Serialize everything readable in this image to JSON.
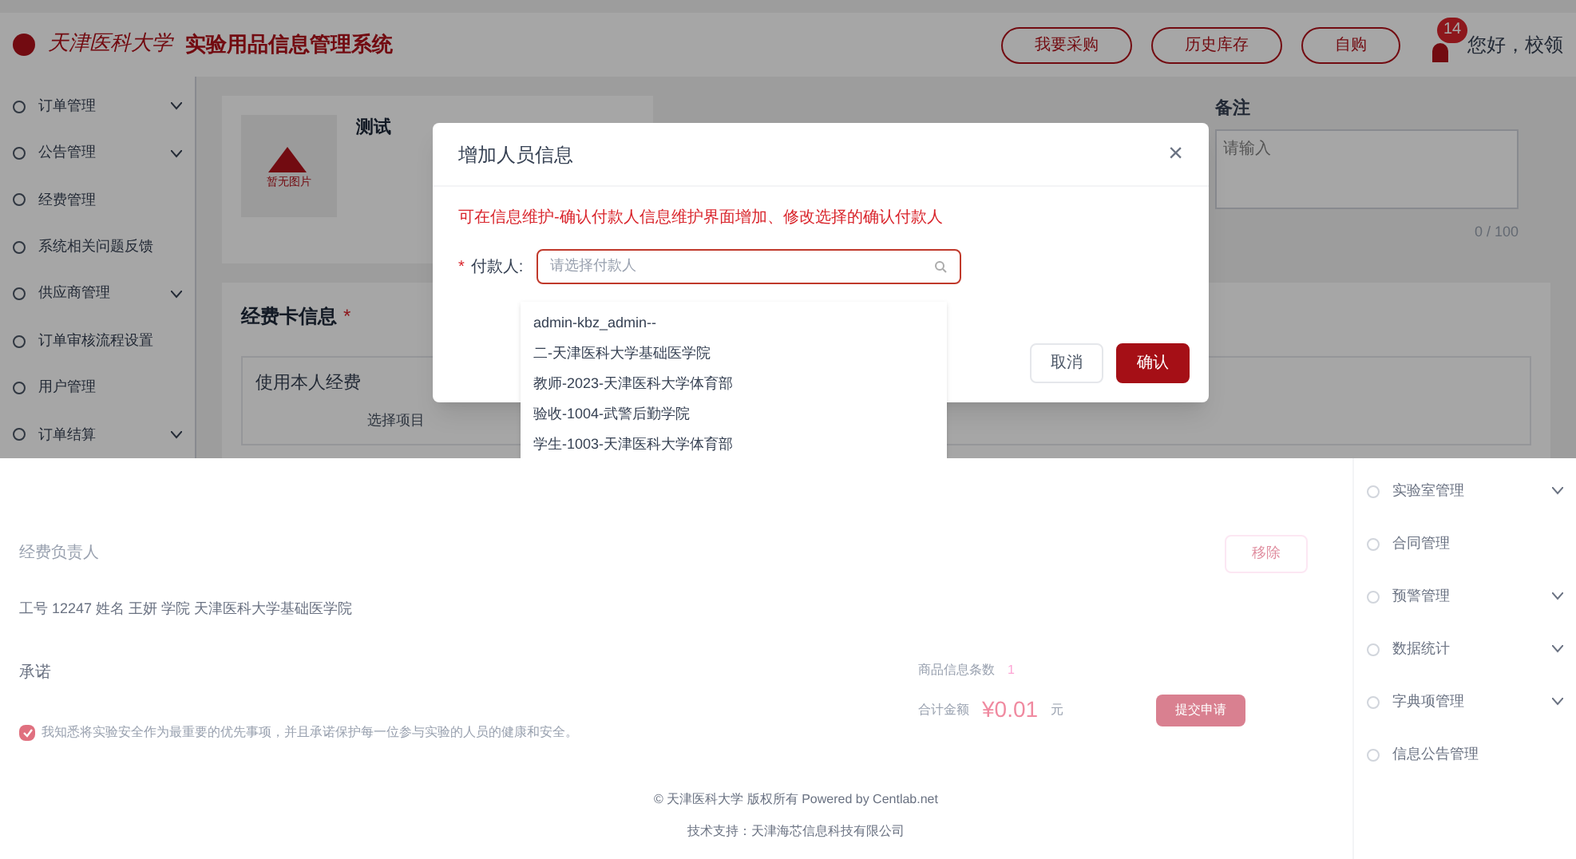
{
  "header": {
    "logo": "天津医科大学",
    "system_title": "实验用品信息管理系统",
    "buttons": [
      "我要采购",
      "历史库存",
      "自购"
    ],
    "notification_count": "14",
    "greeting": "您好，校领"
  },
  "sidebar": {
    "items": [
      {
        "label": "订单管理",
        "expandable": true
      },
      {
        "label": "公告管理",
        "expandable": true
      },
      {
        "label": "经费管理",
        "expandable": false
      },
      {
        "label": "系统相关问题反馈",
        "expandable": false
      },
      {
        "label": "供应商管理",
        "expandable": true
      },
      {
        "label": "订单审核流程设置",
        "expandable": false
      },
      {
        "label": "用户管理",
        "expandable": false
      },
      {
        "label": "订单结算",
        "expandable": true
      }
    ]
  },
  "product": {
    "image_caption": "暂无图片",
    "name": "测试"
  },
  "remark": {
    "label": "备注",
    "placeholder": "请输入",
    "counter": "0 / 100"
  },
  "fund_card": {
    "title": "经费卡信息",
    "required_mark": "*",
    "option": "使用本人经费",
    "select_label": "选择项目"
  },
  "dialog": {
    "title": "增加人员信息",
    "close": "×",
    "notice": "可在信息维护-确认付款人信息维护界面增加、修改选择的确认付款人",
    "field_label": "付款人:",
    "required_mark": "*",
    "placeholder": "请选择付款人",
    "options": [
      "admin-kbz_admin--",
      "二-天津医科大学基础医学院",
      "教师-2023-天津医科大学体育部",
      "验收-1004-武警后勤学院",
      "学生-1003-天津医科大学体育部"
    ],
    "buttons": [
      {
        "label": "取消",
        "kind": "secondary"
      },
      {
        "label": "确认",
        "kind": "primary"
      }
    ]
  },
  "fund_owner": {
    "title": "经费负责人",
    "details": "工号 12247 姓名 王妍 学院 天津医科大学基础医学院"
  },
  "remove_button": "移除",
  "pledge": {
    "title": "承诺",
    "checked": true,
    "text": "我知悉将实验安全作为最重要的优先事项，并且承诺保护每一位参与实验的人员的健康和安全。"
  },
  "summary": {
    "count_label": "商品信息条数",
    "count": "1",
    "total_label": "合计金额",
    "total": "¥0.01",
    "unit": "元",
    "submit": "提交申请"
  },
  "footer": [
    "© 天津医科大学 版权所有 Powered by Centlab.net",
    "技术支持：天津海芯信息科技有限公司"
  ],
  "right_menu": {
    "items": [
      {
        "label": "实验室管理",
        "expandable": true
      },
      {
        "label": "合同管理",
        "expandable": false
      },
      {
        "label": "预警管理",
        "expandable": true
      },
      {
        "label": "数据统计",
        "expandable": true
      },
      {
        "label": "字典项管理",
        "expandable": true
      },
      {
        "label": "信息公告管理",
        "expandable": false
      }
    ]
  }
}
